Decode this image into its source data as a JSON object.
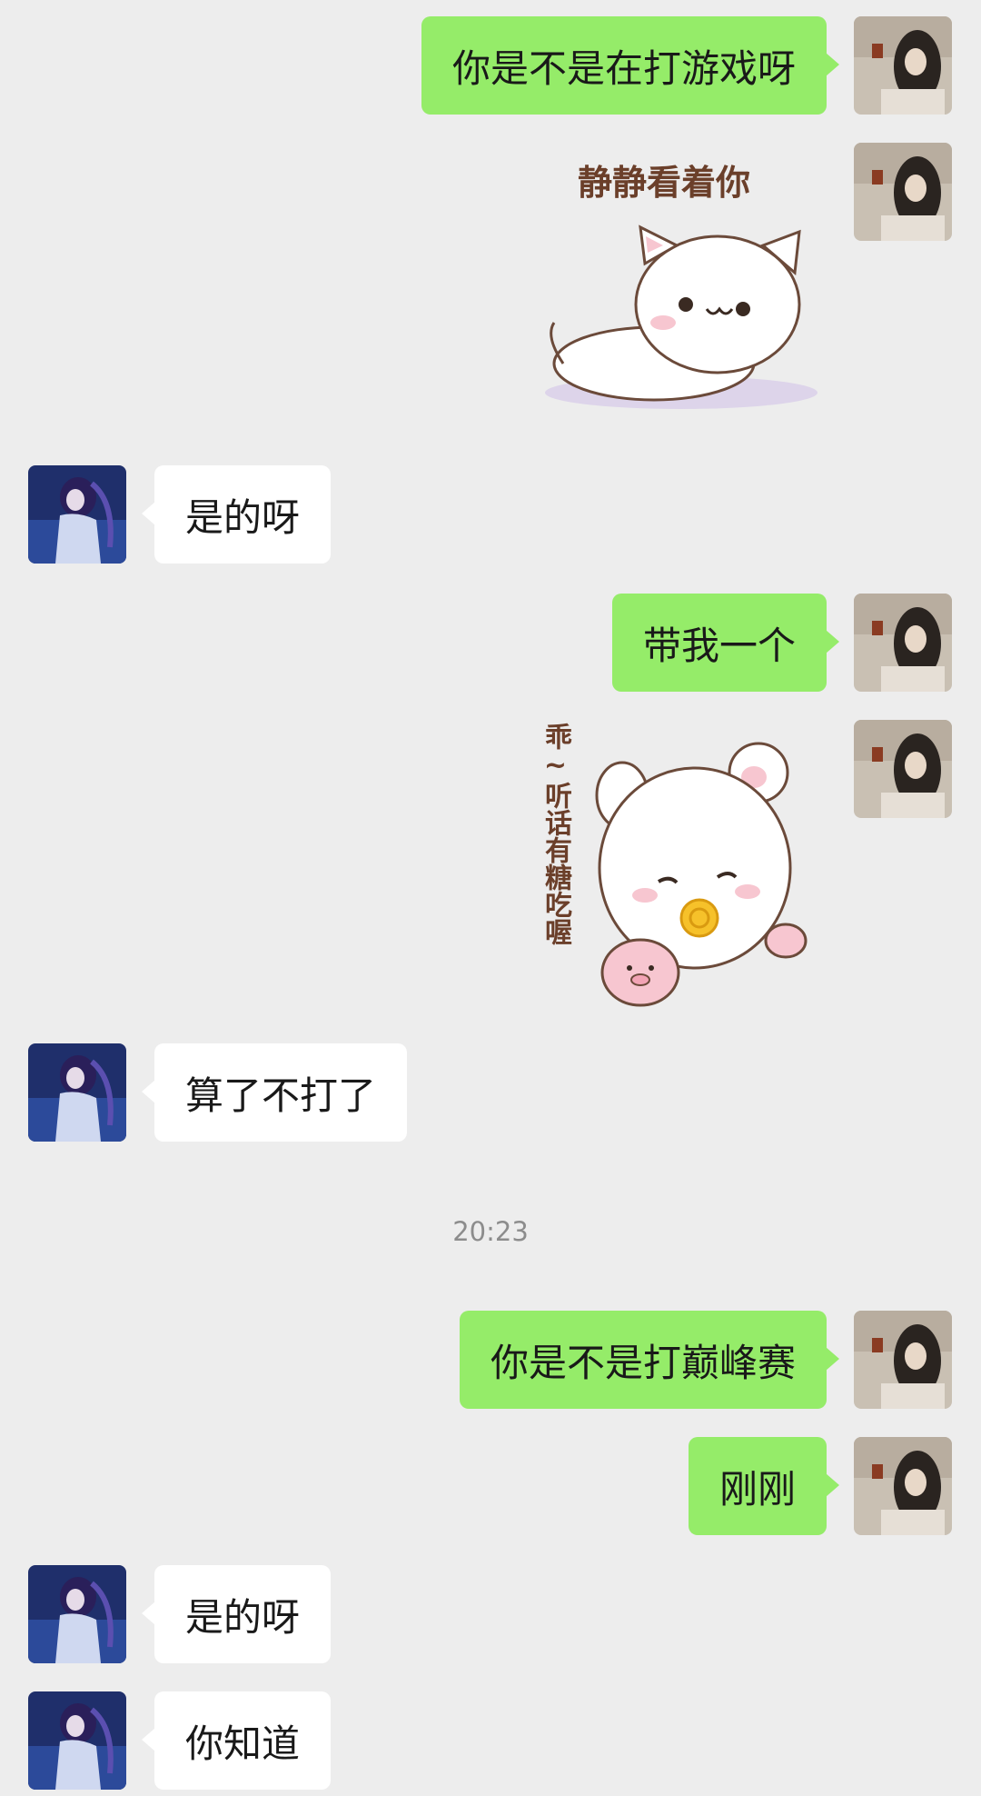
{
  "messages": [
    {
      "sender": "me",
      "text": "你是不是在打游戏呀"
    },
    {
      "sender": "me",
      "type": "sticker",
      "caption": "静静看着你"
    },
    {
      "sender": "other",
      "text": "是的呀"
    },
    {
      "sender": "me",
      "text": "带我一个"
    },
    {
      "sender": "me",
      "type": "sticker",
      "caption": "乖~听话有糖吃喔"
    },
    {
      "sender": "other",
      "text": "算了不打了"
    },
    {
      "sender": "me",
      "text": "你是不是打巅峰赛"
    },
    {
      "sender": "me",
      "text": "刚刚"
    },
    {
      "sender": "other",
      "text": "是的呀"
    },
    {
      "sender": "other",
      "text": "你知道"
    }
  ],
  "timestamp": "20:23",
  "colors": {
    "background": "#ededed",
    "my_bubble": "#95ec69",
    "other_bubble": "#ffffff"
  }
}
